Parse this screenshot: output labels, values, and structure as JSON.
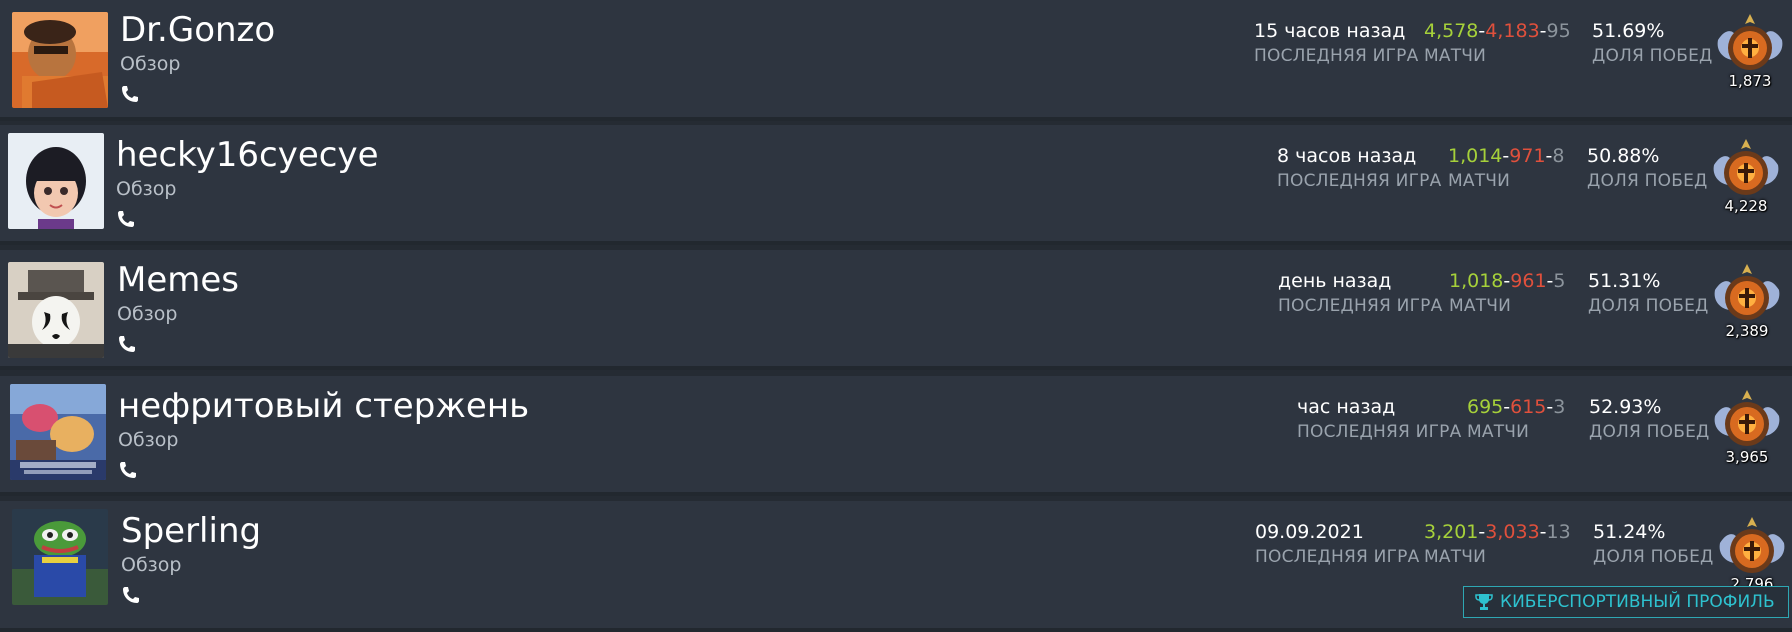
{
  "common": {
    "overview_label": "Обзор",
    "last_game_label": "ПОСЛЕДНЯЯ ИГРА",
    "matches_label": "МАТЧИ",
    "winrate_label": "ДОЛЯ ПОБЕД",
    "sep": "-"
  },
  "players": [
    {
      "name": "Dr.Gonzo",
      "last_game": "15 часов назад",
      "wins": "4,578",
      "losses": "4,183",
      "abandons": "95",
      "winrate": "51.69%",
      "rank": "1,873",
      "avatar": "man-with-sunglasses-avatar"
    },
    {
      "name": "hecky16cyecye",
      "last_game": "8 часов назад",
      "wins": "1,014",
      "losses": "971",
      "abandons": "8",
      "winrate": "50.88%",
      "rank": "4,228",
      "avatar": "doll-girl-avatar"
    },
    {
      "name": "Memes",
      "last_game": "день назад",
      "wins": "1,018",
      "losses": "961",
      "abandons": "5",
      "winrate": "51.31%",
      "rank": "2,389",
      "avatar": "rorschach-avatar"
    },
    {
      "name": "нефритовый стержень",
      "last_game": "час назад",
      "wins": "695",
      "losses": "615",
      "abandons": "3",
      "winrate": "52.93%",
      "rank": "3,965",
      "avatar": "techies-card-avatar"
    },
    {
      "name": "Sperling",
      "last_game": "09.09.2021",
      "wins": "3,201",
      "losses": "3,033",
      "abandons": "13",
      "winrate": "51.24%",
      "rank": "2,796",
      "avatar": "pepe-frog-avatar"
    }
  ],
  "esports_button": "КИБЕРСПОРТИВНЫЙ ПРОФИЛЬ",
  "colors": {
    "background": "#252b33",
    "row": "#2e3540",
    "wins": "#a6d13a",
    "losses": "#e0503c",
    "abandons": "#8c949c",
    "accent": "#2ec2cf"
  }
}
